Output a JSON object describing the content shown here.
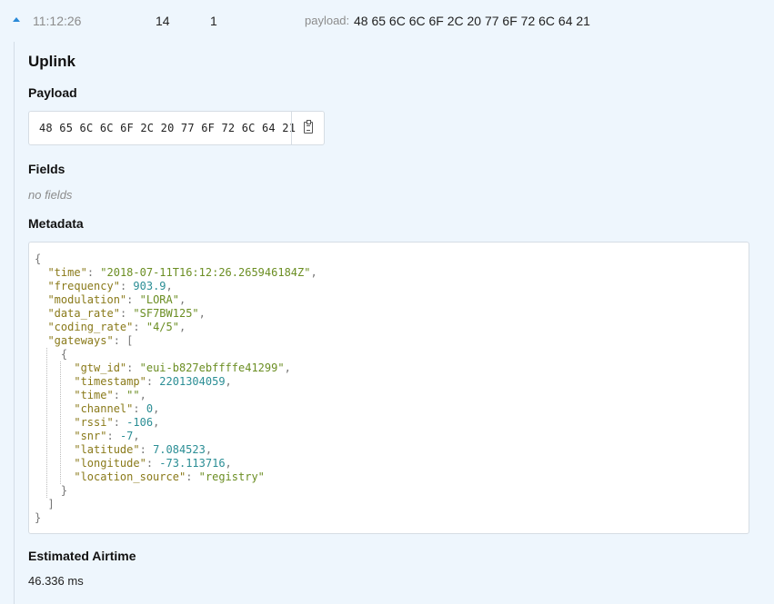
{
  "header": {
    "time": "11:12:26",
    "counter": "14",
    "port": "1",
    "payload_label": "payload:",
    "payload_value": "48 65 6C 6C 6F 2C 20 77 6F 72 6C 64 21"
  },
  "uplink": {
    "title": "Uplink",
    "payload": {
      "title": "Payload",
      "hex": "48 65 6C 6C 6F 2C 20 77 6F 72 6C 64 21",
      "copy_icon": "clipboard-icon"
    },
    "fields": {
      "title": "Fields",
      "empty_text": "no fields"
    },
    "metadata": {
      "title": "Metadata",
      "time": "2018-07-11T16:12:26.265946184Z",
      "frequency": "903.9",
      "modulation": "LORA",
      "data_rate": "SF7BW125",
      "coding_rate": "4/5",
      "gateways": [
        {
          "gtw_id": "eui-b827ebffffe41299",
          "timestamp": "2201304059",
          "time": "",
          "channel": "0",
          "rssi": "-106",
          "snr": "-7",
          "latitude": "7.084523",
          "longitude": "-73.113716",
          "location_source": "registry"
        }
      ]
    },
    "airtime": {
      "title": "Estimated Airtime",
      "value": "46.336 ms"
    }
  },
  "colors": {
    "background": "#eef6fd",
    "json_key": "#8a7a1a",
    "json_string": "#6b8e23",
    "json_number": "#2b8e95",
    "accent": "#2a8ad8"
  }
}
